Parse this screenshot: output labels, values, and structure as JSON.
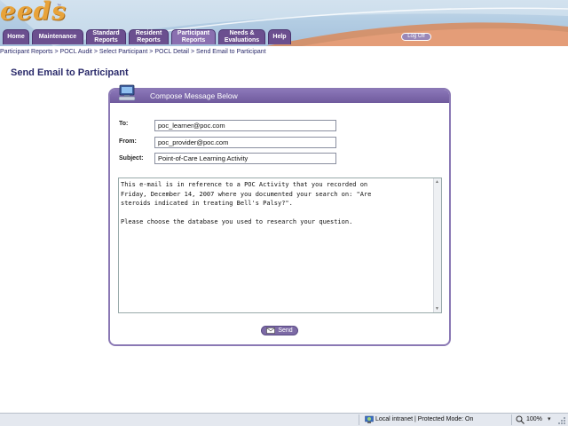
{
  "app": {
    "logo_text": "eeds",
    "logo_tm": "™"
  },
  "nav": {
    "tabs": [
      {
        "label": "Home",
        "active": false
      },
      {
        "label": "Maintenance",
        "active": false
      },
      {
        "label": "Standard Reports",
        "active": false
      },
      {
        "label": "Resident Reports",
        "active": false
      },
      {
        "label": "Participant Reports",
        "active": true
      },
      {
        "label": "Needs & Evaluations",
        "active": false
      },
      {
        "label": "Help",
        "active": false
      }
    ],
    "logout_label": "Log Off"
  },
  "breadcrumb": {
    "items": [
      "Participant Reports",
      "POCL Audit",
      "Select Participant",
      "POCL Detail",
      "Send Email to Participant"
    ],
    "separator": ">"
  },
  "page": {
    "title": "Send Email to Participant"
  },
  "compose": {
    "header": "Compose Message Below",
    "to_label": "To:",
    "to_value": "poc_learner@poc.com",
    "from_label": "From:",
    "from_value": "poc_provider@poc.com",
    "subject_label": "Subject:",
    "subject_value": "Point-of-Care Learning Activity",
    "message": "This e-mail is in reference to a POC Activity that you recorded on\nFriday, December 14, 2007 where you documented your search on: \"Are\nsteroids indicated in treating Bell's Palsy?\".\n\nPlease choose the database you used to research your question.",
    "send_label": "Send"
  },
  "statusbar": {
    "zone": "Local intranet | Protected Mode: On",
    "zoom": "100%"
  },
  "colors": {
    "nav_purple": "#6b4f8f",
    "panel_border": "#8a78b4",
    "logo_orange": "#e8a33a",
    "title_navy": "#2b2b6b"
  },
  "icons": [
    "computer-icon",
    "envelope-icon",
    "globe-icon",
    "zoom-icon",
    "chevron-down-icon",
    "scroll-up-icon",
    "scroll-down-icon"
  ]
}
